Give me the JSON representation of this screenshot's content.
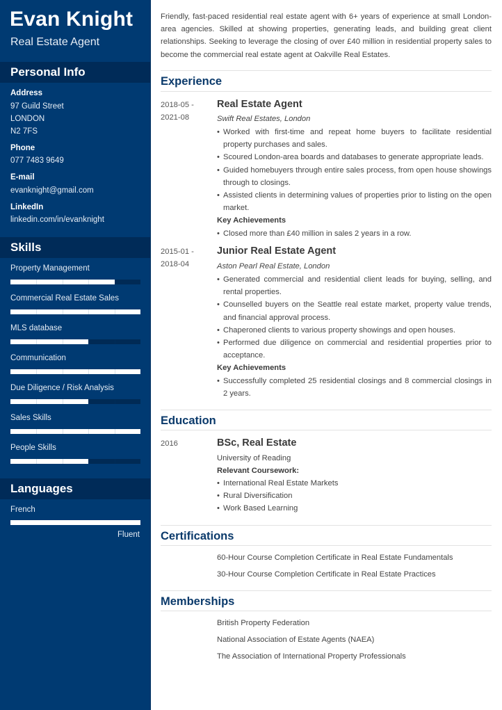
{
  "profile": {
    "name": "Evan Knight",
    "title": "Real Estate Agent"
  },
  "sidebar": {
    "personal_info": {
      "heading": "Personal Info",
      "address_label": "Address",
      "address_lines": [
        "97 Guild Street",
        "LONDON",
        "N2 7FS"
      ],
      "phone_label": "Phone",
      "phone": "077 7483 9649",
      "email_label": "E-mail",
      "email": "evanknight@gmail.com",
      "linkedin_label": "LinkedIn",
      "linkedin": "linkedin.com/in/evanknight"
    },
    "skills": {
      "heading": "Skills",
      "items": [
        {
          "name": "Property Management",
          "level": 0.8
        },
        {
          "name": "Commercial Real Estate Sales",
          "level": 1.0
        },
        {
          "name": "MLS database",
          "level": 0.6
        },
        {
          "name": "Communication",
          "level": 1.0
        },
        {
          "name": "Due Diligence / Risk Analysis",
          "level": 0.6
        },
        {
          "name": "Sales Skills",
          "level": 1.0
        },
        {
          "name": "People Skills",
          "level": 0.6
        }
      ]
    },
    "languages": {
      "heading": "Languages",
      "items": [
        {
          "name": "French",
          "level": 1.0,
          "level_label": "Fluent"
        }
      ]
    }
  },
  "main": {
    "summary": "Friendly, fast-paced residential real estate agent with 6+ years of experience at small London-area agencies. Skilled at showing properties, generating leads, and building great client relationships. Seeking to leverage the closing of over £40 million in residential property sales to become the commercial real estate agent at Oakville Real Estates.",
    "experience": {
      "heading": "Experience",
      "jobs": [
        {
          "date_start": "2018-05 -",
          "date_end": "2021-08",
          "title": "Real Estate Agent",
          "company": "Swift Real Estates, London",
          "bullets": [
            "Worked with first-time and repeat home buyers to facilitate residential property purchases and sales.",
            "Scoured London-area boards and databases to generate appropriate leads.",
            "Guided homebuyers through entire sales process, from open house showings through to closings.",
            "Assisted clients in determining values of properties prior to listing on the open market."
          ],
          "achievements_label": "Key Achievements",
          "achievements": [
            "Closed more than £40 million in sales 2 years in a row."
          ]
        },
        {
          "date_start": "2015-01 -",
          "date_end": "2018-04",
          "title": "Junior Real Estate Agent",
          "company": "Aston Pearl Real Estate, London",
          "bullets": [
            "Generated commercial and residential client leads for buying, selling, and rental properties.",
            "Counselled buyers on the Seattle real estate market, property value trends, and financial approval process.",
            "Chaperoned clients to various property showings and open houses.",
            "Performed due diligence on commercial and residential properties prior to acceptance."
          ],
          "achievements_label": "Key Achievements",
          "achievements": [
            "Successfully completed 25 residential closings and 8 commercial closings in 2 years."
          ]
        }
      ]
    },
    "education": {
      "heading": "Education",
      "date": "2016",
      "degree": "BSc, Real Estate",
      "school": "University of Reading",
      "coursework_label": "Relevant Coursework:",
      "coursework": [
        "International Real Estate Markets",
        "Rural Diversification",
        "Work Based Learning"
      ]
    },
    "certifications": {
      "heading": "Certifications",
      "items": [
        "60-Hour Course Completion Certificate in Real Estate Fundamentals",
        "30-Hour Course Completion Certificate in Real Estate Practices"
      ]
    },
    "memberships": {
      "heading": "Memberships",
      "items": [
        "British Property Federation",
        "National Association of Estate Agents (NAEA)",
        "The Association of International Property Professionals"
      ]
    }
  }
}
